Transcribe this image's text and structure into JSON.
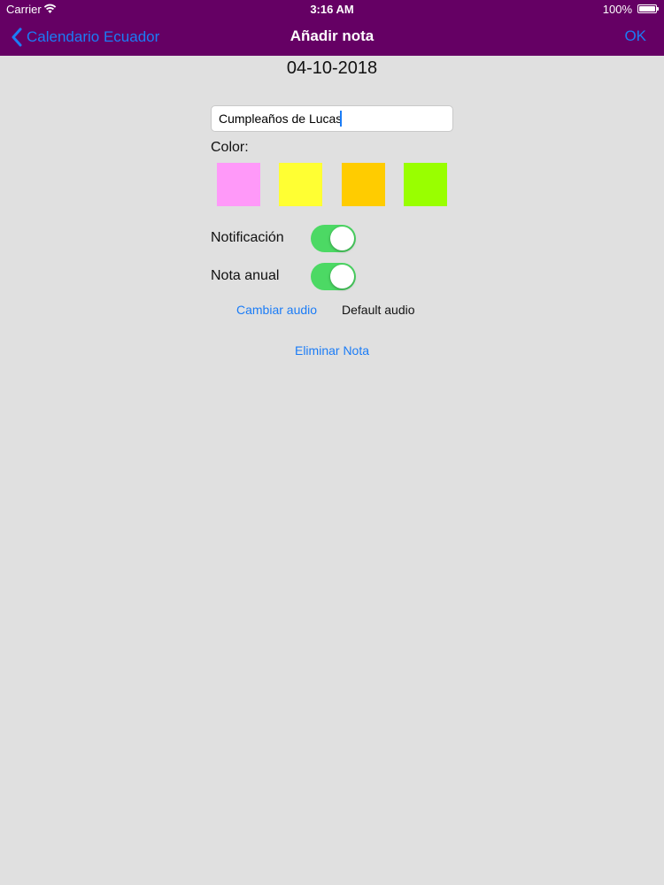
{
  "status": {
    "carrier": "Carrier",
    "time": "3:16 AM",
    "battery": "100%"
  },
  "nav": {
    "back_label": "Calendario Ecuador",
    "title": "Añadir nota",
    "ok_label": "OK"
  },
  "date": "04-10-2018",
  "note": {
    "name_value": "Cumpleaños de Lucas"
  },
  "color": {
    "label": "Color:",
    "swatches": [
      "#ff99f9",
      "#ffff33",
      "#ffcc00",
      "#99ff00"
    ]
  },
  "toggles": {
    "notification_label": "Notificación",
    "notification_on": true,
    "annual_label": "Nota anual",
    "annual_on": true
  },
  "audio": {
    "change_label": "Cambiar audio",
    "current_value": "Default audio"
  },
  "delete_label": "Eliminar Nota",
  "colors": {
    "nav_bg": "#650064",
    "accent": "#1b7cf6",
    "toggle_on": "#4cd964",
    "page_bg": "#e0e0e0"
  },
  "icons": {
    "back": "chevron-left-icon",
    "wifi": "wifi-icon",
    "battery": "battery-icon"
  }
}
